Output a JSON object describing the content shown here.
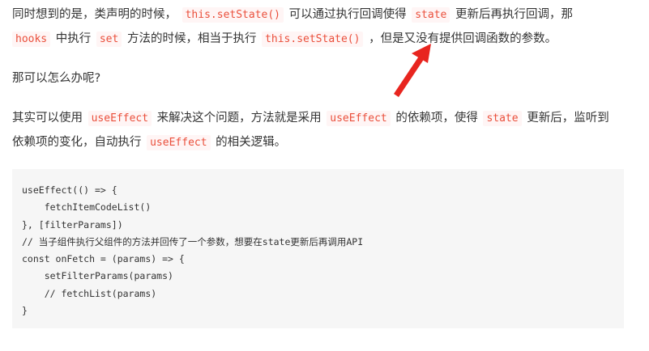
{
  "paragraph1": {
    "line1": {
      "t1": "同时想到的是，类声明的时候，",
      "c1": "this.setState()",
      "t2": "可以通过执行回调使得",
      "c2": "state",
      "t3": "更新后再执行回调，那"
    },
    "line2": {
      "c1": "hooks",
      "t1": "中执行",
      "c2": "set",
      "t2": "方法的时候，相当于执行",
      "c3": "this.setState()",
      "t3": "，但是又没有提供回调函数的参数。"
    }
  },
  "paragraph2": {
    "text": "那可以怎么办呢?"
  },
  "paragraph3": {
    "line1": {
      "t1": "其实可以使用",
      "c1": "useEffect",
      "t2": "来解决这个问题，方法就是采用",
      "c2": "useEffect",
      "t3": "的依赖项，使得",
      "c3": "state",
      "t4": "更新后，监听到"
    },
    "line2": {
      "t1": "依赖项的变化，自动执行",
      "c1": "useEffect",
      "t2": "的相关逻辑。"
    }
  },
  "code_block": {
    "lines": [
      "useEffect(() => {",
      "    fetchItemCodeList()",
      "}, [filterParams])",
      "// 当子组件执行父组件的方法并回传了一个参数，想要在state更新后再调用API",
      "const onFetch = (params) => {",
      "    setFilterParams(params)",
      "    // fetchList(params)",
      "}"
    ]
  },
  "annotation": {
    "arrow_color": "#e8251f",
    "icon": "red-arrow-icon"
  },
  "colors": {
    "text": "#333333",
    "inline_code": "#ea4f3b",
    "code_background": "#f6f6f6"
  }
}
